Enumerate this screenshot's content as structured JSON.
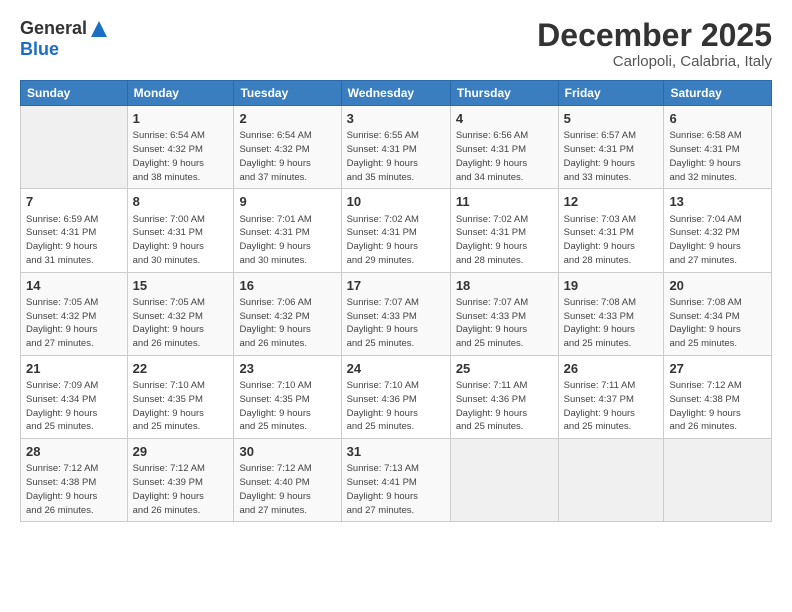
{
  "logo": {
    "general": "General",
    "blue": "Blue"
  },
  "title": "December 2025",
  "subtitle": "Carlopoli, Calabria, Italy",
  "days_header": [
    "Sunday",
    "Monday",
    "Tuesday",
    "Wednesday",
    "Thursday",
    "Friday",
    "Saturday"
  ],
  "weeks": [
    [
      {
        "num": "",
        "info": ""
      },
      {
        "num": "1",
        "info": "Sunrise: 6:54 AM\nSunset: 4:32 PM\nDaylight: 9 hours\nand 38 minutes."
      },
      {
        "num": "2",
        "info": "Sunrise: 6:54 AM\nSunset: 4:32 PM\nDaylight: 9 hours\nand 37 minutes."
      },
      {
        "num": "3",
        "info": "Sunrise: 6:55 AM\nSunset: 4:31 PM\nDaylight: 9 hours\nand 35 minutes."
      },
      {
        "num": "4",
        "info": "Sunrise: 6:56 AM\nSunset: 4:31 PM\nDaylight: 9 hours\nand 34 minutes."
      },
      {
        "num": "5",
        "info": "Sunrise: 6:57 AM\nSunset: 4:31 PM\nDaylight: 9 hours\nand 33 minutes."
      },
      {
        "num": "6",
        "info": "Sunrise: 6:58 AM\nSunset: 4:31 PM\nDaylight: 9 hours\nand 32 minutes."
      }
    ],
    [
      {
        "num": "7",
        "info": "Sunrise: 6:59 AM\nSunset: 4:31 PM\nDaylight: 9 hours\nand 31 minutes."
      },
      {
        "num": "8",
        "info": "Sunrise: 7:00 AM\nSunset: 4:31 PM\nDaylight: 9 hours\nand 30 minutes."
      },
      {
        "num": "9",
        "info": "Sunrise: 7:01 AM\nSunset: 4:31 PM\nDaylight: 9 hours\nand 30 minutes."
      },
      {
        "num": "10",
        "info": "Sunrise: 7:02 AM\nSunset: 4:31 PM\nDaylight: 9 hours\nand 29 minutes."
      },
      {
        "num": "11",
        "info": "Sunrise: 7:02 AM\nSunset: 4:31 PM\nDaylight: 9 hours\nand 28 minutes."
      },
      {
        "num": "12",
        "info": "Sunrise: 7:03 AM\nSunset: 4:31 PM\nDaylight: 9 hours\nand 28 minutes."
      },
      {
        "num": "13",
        "info": "Sunrise: 7:04 AM\nSunset: 4:32 PM\nDaylight: 9 hours\nand 27 minutes."
      }
    ],
    [
      {
        "num": "14",
        "info": "Sunrise: 7:05 AM\nSunset: 4:32 PM\nDaylight: 9 hours\nand 27 minutes."
      },
      {
        "num": "15",
        "info": "Sunrise: 7:05 AM\nSunset: 4:32 PM\nDaylight: 9 hours\nand 26 minutes."
      },
      {
        "num": "16",
        "info": "Sunrise: 7:06 AM\nSunset: 4:32 PM\nDaylight: 9 hours\nand 26 minutes."
      },
      {
        "num": "17",
        "info": "Sunrise: 7:07 AM\nSunset: 4:33 PM\nDaylight: 9 hours\nand 25 minutes."
      },
      {
        "num": "18",
        "info": "Sunrise: 7:07 AM\nSunset: 4:33 PM\nDaylight: 9 hours\nand 25 minutes."
      },
      {
        "num": "19",
        "info": "Sunrise: 7:08 AM\nSunset: 4:33 PM\nDaylight: 9 hours\nand 25 minutes."
      },
      {
        "num": "20",
        "info": "Sunrise: 7:08 AM\nSunset: 4:34 PM\nDaylight: 9 hours\nand 25 minutes."
      }
    ],
    [
      {
        "num": "21",
        "info": "Sunrise: 7:09 AM\nSunset: 4:34 PM\nDaylight: 9 hours\nand 25 minutes."
      },
      {
        "num": "22",
        "info": "Sunrise: 7:10 AM\nSunset: 4:35 PM\nDaylight: 9 hours\nand 25 minutes."
      },
      {
        "num": "23",
        "info": "Sunrise: 7:10 AM\nSunset: 4:35 PM\nDaylight: 9 hours\nand 25 minutes."
      },
      {
        "num": "24",
        "info": "Sunrise: 7:10 AM\nSunset: 4:36 PM\nDaylight: 9 hours\nand 25 minutes."
      },
      {
        "num": "25",
        "info": "Sunrise: 7:11 AM\nSunset: 4:36 PM\nDaylight: 9 hours\nand 25 minutes."
      },
      {
        "num": "26",
        "info": "Sunrise: 7:11 AM\nSunset: 4:37 PM\nDaylight: 9 hours\nand 25 minutes."
      },
      {
        "num": "27",
        "info": "Sunrise: 7:12 AM\nSunset: 4:38 PM\nDaylight: 9 hours\nand 26 minutes."
      }
    ],
    [
      {
        "num": "28",
        "info": "Sunrise: 7:12 AM\nSunset: 4:38 PM\nDaylight: 9 hours\nand 26 minutes."
      },
      {
        "num": "29",
        "info": "Sunrise: 7:12 AM\nSunset: 4:39 PM\nDaylight: 9 hours\nand 26 minutes."
      },
      {
        "num": "30",
        "info": "Sunrise: 7:12 AM\nSunset: 4:40 PM\nDaylight: 9 hours\nand 27 minutes."
      },
      {
        "num": "31",
        "info": "Sunrise: 7:13 AM\nSunset: 4:41 PM\nDaylight: 9 hours\nand 27 minutes."
      },
      {
        "num": "",
        "info": ""
      },
      {
        "num": "",
        "info": ""
      },
      {
        "num": "",
        "info": ""
      }
    ]
  ]
}
